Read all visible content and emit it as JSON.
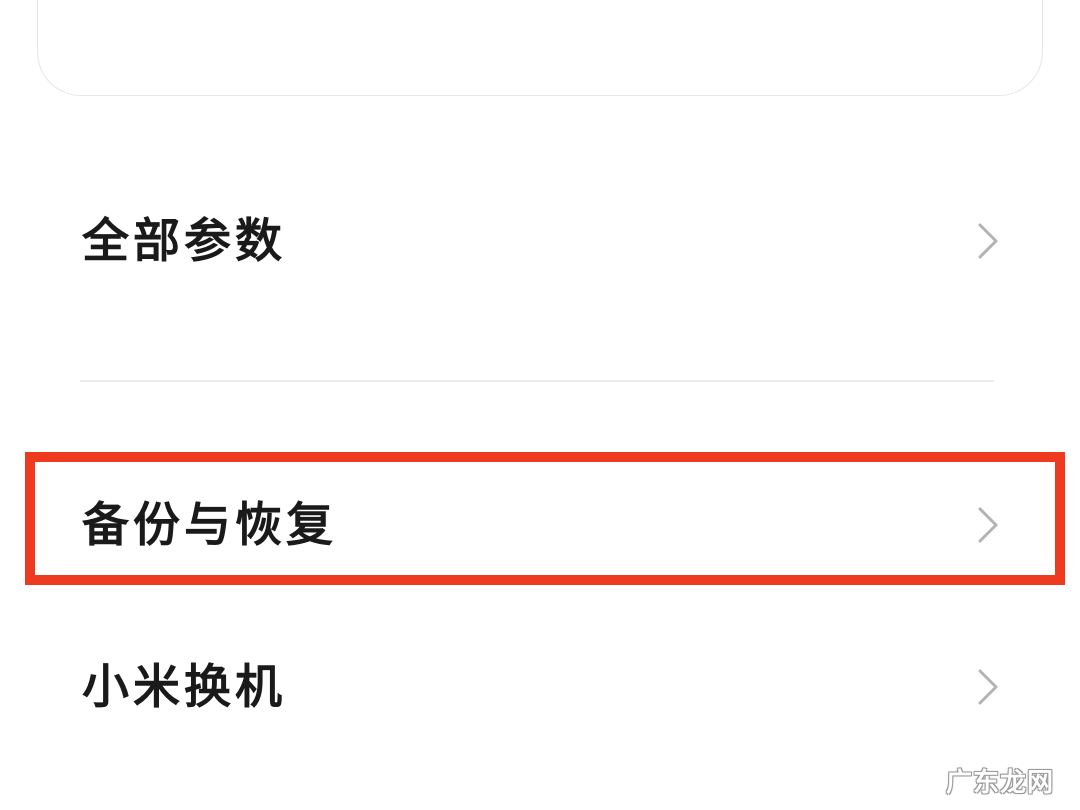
{
  "settings": {
    "items": [
      {
        "label": "全部参数"
      },
      {
        "label": "备份与恢复",
        "highlighted": true
      },
      {
        "label": "小米换机"
      }
    ]
  },
  "annotation": {
    "highlight_color": "#ee3a1f"
  },
  "icons": {
    "row_chevron": "chevron-right-icon"
  },
  "watermark": {
    "text": "广东龙网"
  }
}
